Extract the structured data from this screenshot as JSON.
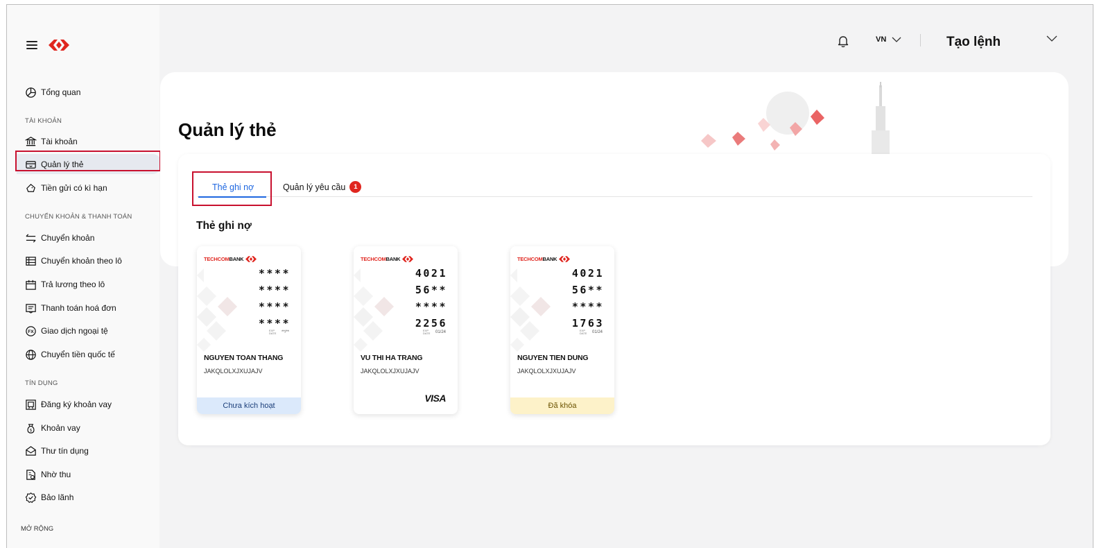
{
  "sidebar": {
    "items": [
      {
        "label": "Tổng quan"
      },
      {
        "label": "Tài khoản"
      },
      {
        "label": "Quản lý thẻ"
      },
      {
        "label": "Tiền gửi có kì hạn"
      },
      {
        "label": "Chuyển khoản"
      },
      {
        "label": "Chuyển khoản theo lô"
      },
      {
        "label": "Trả lương theo lô"
      },
      {
        "label": "Thanh toán hoá đơn"
      },
      {
        "label": "Giao dịch ngoại tệ"
      },
      {
        "label": "Chuyển tiền quốc tế"
      },
      {
        "label": "Đăng ký khoản vay"
      },
      {
        "label": "Khoản vay"
      },
      {
        "label": "Thư tín dụng"
      },
      {
        "label": "Nhờ thu"
      },
      {
        "label": "Bảo lãnh"
      }
    ],
    "sections": {
      "accounts": "TÀI KHOẢN",
      "transfers": "CHUYỂN KHOẢN & THANH TOÁN",
      "credit": "TÍN DỤNG"
    },
    "expand_label": "MỞ RỘNG",
    "active_item": "Quản lý thẻ"
  },
  "topbar": {
    "language": "VN",
    "create_order": "Tạo lệnh"
  },
  "page": {
    "title": "Quản lý thẻ",
    "tabs": [
      {
        "label": "Thẻ ghi nợ",
        "active": true
      },
      {
        "label": "Quản lý yêu cầu",
        "badge": "1"
      }
    ],
    "section_title": "Thẻ ghi nợ"
  },
  "cards": [
    {
      "brand_red": "TECHCOM",
      "brand_dark": "BANK",
      "number_groups": [
        "****",
        "****",
        "****",
        "****"
      ],
      "exp_label": "EXP DATE",
      "exp": "**/**",
      "holder": "NGUYEN TOAN THANG",
      "account": "JAKQLOLXJXUJAJV",
      "status": "Chưa kích hoạt"
    },
    {
      "brand_red": "TECHCOM",
      "brand_dark": "BANK",
      "number_groups": [
        "4021",
        "56**",
        "****",
        "2256"
      ],
      "exp_label": "EXP DATE",
      "exp": "01/24",
      "holder": "VU THI HA TRANG",
      "account": "JAKQLOLXJXUJAJV",
      "network": "VISA"
    },
    {
      "brand_red": "TECHCOM",
      "brand_dark": "BANK",
      "number_groups": [
        "4021",
        "56**",
        "****",
        "1763"
      ],
      "exp_label": "EXP DATE",
      "exp": "01/24",
      "holder": "NGUYEN TIEN DUNG",
      "account": "JAKQLOLXJXUJAJV",
      "status": "Đã khóa"
    }
  ],
  "colors": {
    "brand_red": "#e0261f",
    "active_tab": "#1d66e0",
    "highlight_box": "#c8102e"
  }
}
